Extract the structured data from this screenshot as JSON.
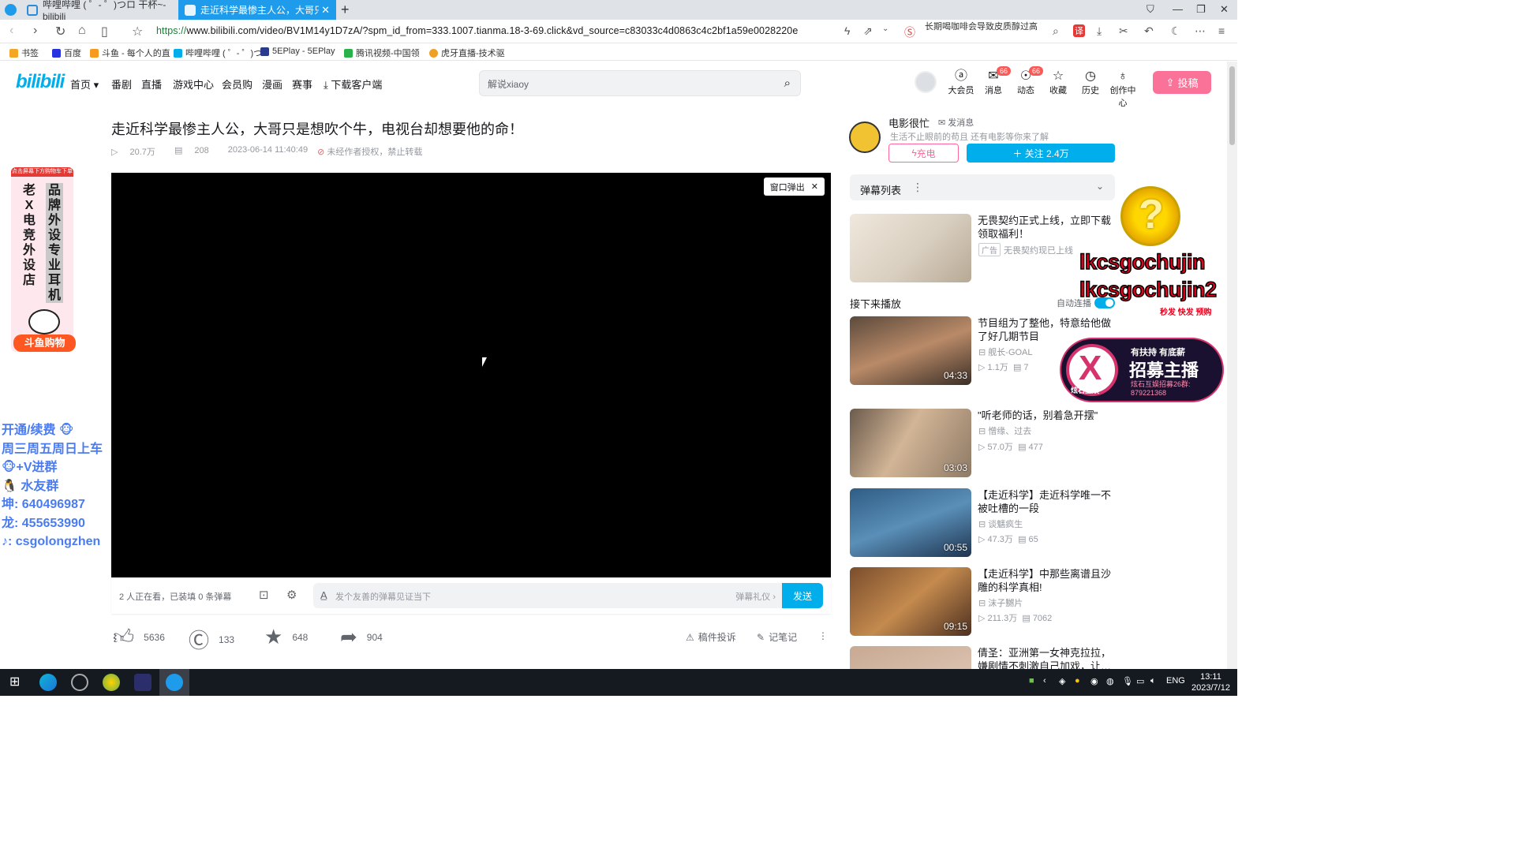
{
  "browser": {
    "tabs": [
      {
        "title": "哔哩哔哩 ( ゜- ゜)つロ 干杯~-bilibili"
      },
      {
        "title": "走近科学最惨主人公，大哥只是想吹…"
      }
    ],
    "url": "https://www.bilibili.com/video/BV1M14y1D7zA/?spm_id_from=333.1007.tianma.18-3-69.click&vd_source=c83033c4d0863c4c2bf1a59e0028220e",
    "hot_search": "长期喝咖啡会导致皮质醇过高",
    "bookmarks": [
      "书签",
      "百度",
      "斗鱼 - 每个人的直",
      "哔哩哔哩 ( ゜- ゜)つ",
      "5EPlay - 5EPlay",
      "腾讯视频-中国领",
      "虎牙直播-技术驱"
    ]
  },
  "header": {
    "logo": "bilibili",
    "nav": [
      "首页 ▾",
      "番剧",
      "直播",
      "游戏中心",
      "会员购",
      "漫画",
      "赛事",
      "下载客户端"
    ],
    "search_placeholder": "解说xiaoy",
    "icons": [
      {
        "label": "大会员",
        "glyph": "ⓐ"
      },
      {
        "label": "消息",
        "glyph": "✉",
        "badge": "66"
      },
      {
        "label": "动态",
        "glyph": "☉",
        "badge": "66"
      },
      {
        "label": "收藏",
        "glyph": "☆"
      },
      {
        "label": "历史",
        "glyph": "◷"
      },
      {
        "label": "创作中心",
        "glyph": "♁"
      }
    ],
    "upload": "投稿"
  },
  "video": {
    "title": "走近科学最惨主人公，大哥只是想吹个牛，电视台却想要他的命！",
    "views": "20.7万",
    "danmaku": "208",
    "date": "2023-06-14 11:40:49",
    "copyright": "未经作者授权，禁止转载",
    "popout": "窗口弹出"
  },
  "danmaku_bar": {
    "watching": "2 人正在看，已装填 0 条弹幕",
    "placeholder": "发个友善的弹幕见证当下",
    "etiquette": "弹幕礼仪 ›",
    "send": "发送"
  },
  "actions": {
    "like": "5636",
    "coin": "133",
    "fav": "648",
    "share": "904",
    "report": "稿件投诉",
    "notes": "记笔记"
  },
  "uploader": {
    "name": "电影很忙",
    "message": "发消息",
    "desc": "生活不止眼前的苟且 还有电影等你来了解",
    "charge": "充电",
    "follow": "＋ 关注 2.4万"
  },
  "danmaku_list": "弹幕列表",
  "ad_card": {
    "title": "无畏契约正式上线，立即下载领取福利！",
    "tag": "广告",
    "sub": "无畏契约现已上线"
  },
  "next_label": "接下来播放",
  "autoplay": "自动连播",
  "recommendations": [
    {
      "title": "节目组为了整他，特意给他做了好几期节目",
      "author": "舰长-GOAL",
      "views": "1.1万",
      "danmaku": "7",
      "duration": "04:33"
    },
    {
      "title": "\"听老师的话，别着急开摆\"",
      "author": "憎缘、过去",
      "views": "57.0万",
      "danmaku": "477",
      "duration": "03:03"
    },
    {
      "title": "【走近科学】走近科学唯一不被吐槽的一段",
      "author": "谈魑疯生",
      "views": "47.3万",
      "danmaku": "65",
      "duration": "00:55"
    },
    {
      "title": "【走近科学】中那些离谱且沙雕的科学真相!",
      "author": "沫子嬲片",
      "views": "211.3万",
      "danmaku": "7062",
      "duration": "09:15"
    },
    {
      "title": "倩圣：亚洲第一女神克拉拉，嫌剧情不刺激自己加戏，让…",
      "author": "",
      "views": "",
      "danmaku": "",
      "duration": ""
    }
  ],
  "overlays": {
    "left_ad_top": "点击屏幕下方购物车下单",
    "left_ad_col1": "老X电竞外设店",
    "left_ad_col2": "品牌外设专业耳机",
    "left_ad_bottom": "斗鱼购物",
    "stream_info": [
      "开通/续费 🐵",
      "周三周五周日上车",
      "🐵+V进群",
      "🐧 水友群",
      "坤: 640496987",
      "龙: 455653990",
      "♪: csgolongzhen"
    ],
    "stream_name_1": "lkcsgochujin",
    "stream_name_2": "lkcsgochujin2",
    "stream_sub": "秒发 快发 预购",
    "recruit_brand": "炫石互娱",
    "recruit_l1": "有扶持 有底薪",
    "recruit_l2": "招募主播",
    "recruit_l3": "炫石互娱招募26群: 879221368"
  },
  "taskbar": {
    "lang": "ENG",
    "time": "13:11",
    "date": "2023/7/12"
  },
  "colors": {
    "bili_blue": "#00aeec",
    "bili_pink": "#fb7299",
    "browser_tab": "#1e9bea"
  }
}
